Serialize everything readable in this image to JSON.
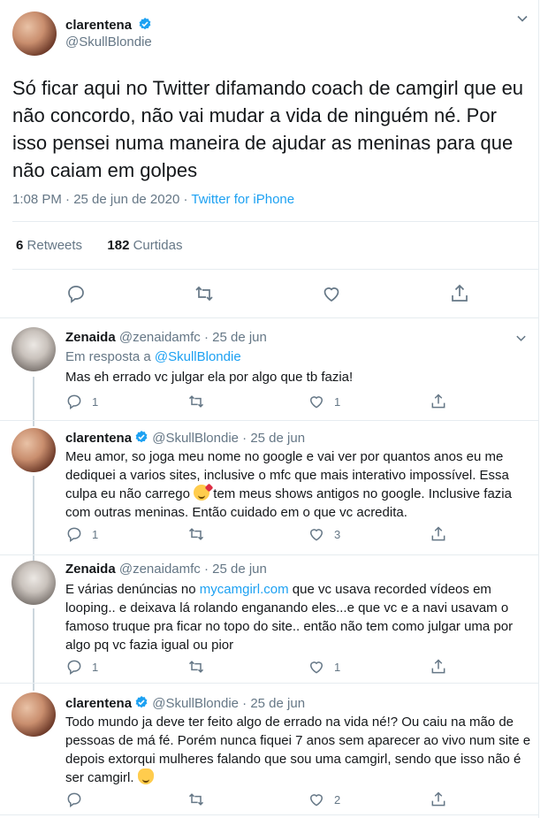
{
  "main_tweet": {
    "name": "clarentena",
    "handle": "@SkullBlondie",
    "text": "Só ficar aqui no Twitter difamando coach de camgirl que eu não concordo, não vai mudar a vida de ninguém né. Por isso pensei numa maneira de ajudar as meninas para que não caiam em golpes",
    "time": "1:08 PM · 25 de jun de 2020 · ",
    "source": "Twitter for iPhone",
    "retweets_count": "6",
    "retweets_label": "Retweets",
    "likes_count": "182",
    "likes_label": "Curtidas"
  },
  "replies": [
    {
      "name": "Zenaida",
      "handle": "@zenaidamfc · 25 de jun",
      "in_reply_prefix": "Em resposta a ",
      "in_reply_handle": "@SkullBlondie",
      "text": "Mas eh errado vc julgar ela por algo que tb fazia!",
      "reply_count": "1",
      "retweet_count": "",
      "like_count": "1"
    },
    {
      "name": "clarentena",
      "handle": "@SkullBlondie · 25 de jun",
      "text_a": "Meu amor, so joga meu nome no google e vai ver por quantos anos eu me dediquei a varios sites, inclusive o mfc que mais interativo impossível. Essa culpa eu não carrego ",
      "text_b": " tem meus shows antigos no google. Inclusive fazia com outras meninas. Então cuidado em o que vc acredita.",
      "reply_count": "1",
      "retweet_count": "",
      "like_count": "3"
    },
    {
      "name": "Zenaida",
      "handle": "@zenaidamfc · 25 de jun",
      "text_a": "E várias denúncias no ",
      "link": "mycamgirl.com",
      "text_b": " que vc usava recorded vídeos em looping.. e deixava lá rolando enganando eles...e que vc e a navi usavam o famoso truque pra ficar no topo do site.. então não tem como julgar uma por algo pq vc fazia igual ou pior",
      "reply_count": "1",
      "retweet_count": "",
      "like_count": "1"
    },
    {
      "name": "clarentena",
      "handle": "@SkullBlondie · 25 de jun",
      "text_a": "Todo mundo ja deve ter feito algo de errado na vida né!? Ou caiu na mão de pessoas de má fé. Porém nunca fiquei 7 anos sem aparecer ao vivo num site e depois extorqui mulheres falando que sou uma camgirl, sendo que isso não é ser camgirl. ",
      "reply_count": "",
      "retweet_count": "",
      "like_count": "2"
    }
  ],
  "icons": {
    "reply": "reply-icon",
    "retweet": "retweet-icon",
    "like": "heart-icon",
    "share": "share-icon",
    "verified": "verified-badge-icon",
    "more": "chevron-down-icon"
  },
  "colors": {
    "accent": "#1da1f2",
    "muted": "#657786",
    "text": "#14171a",
    "divider": "#e6ecf0"
  }
}
